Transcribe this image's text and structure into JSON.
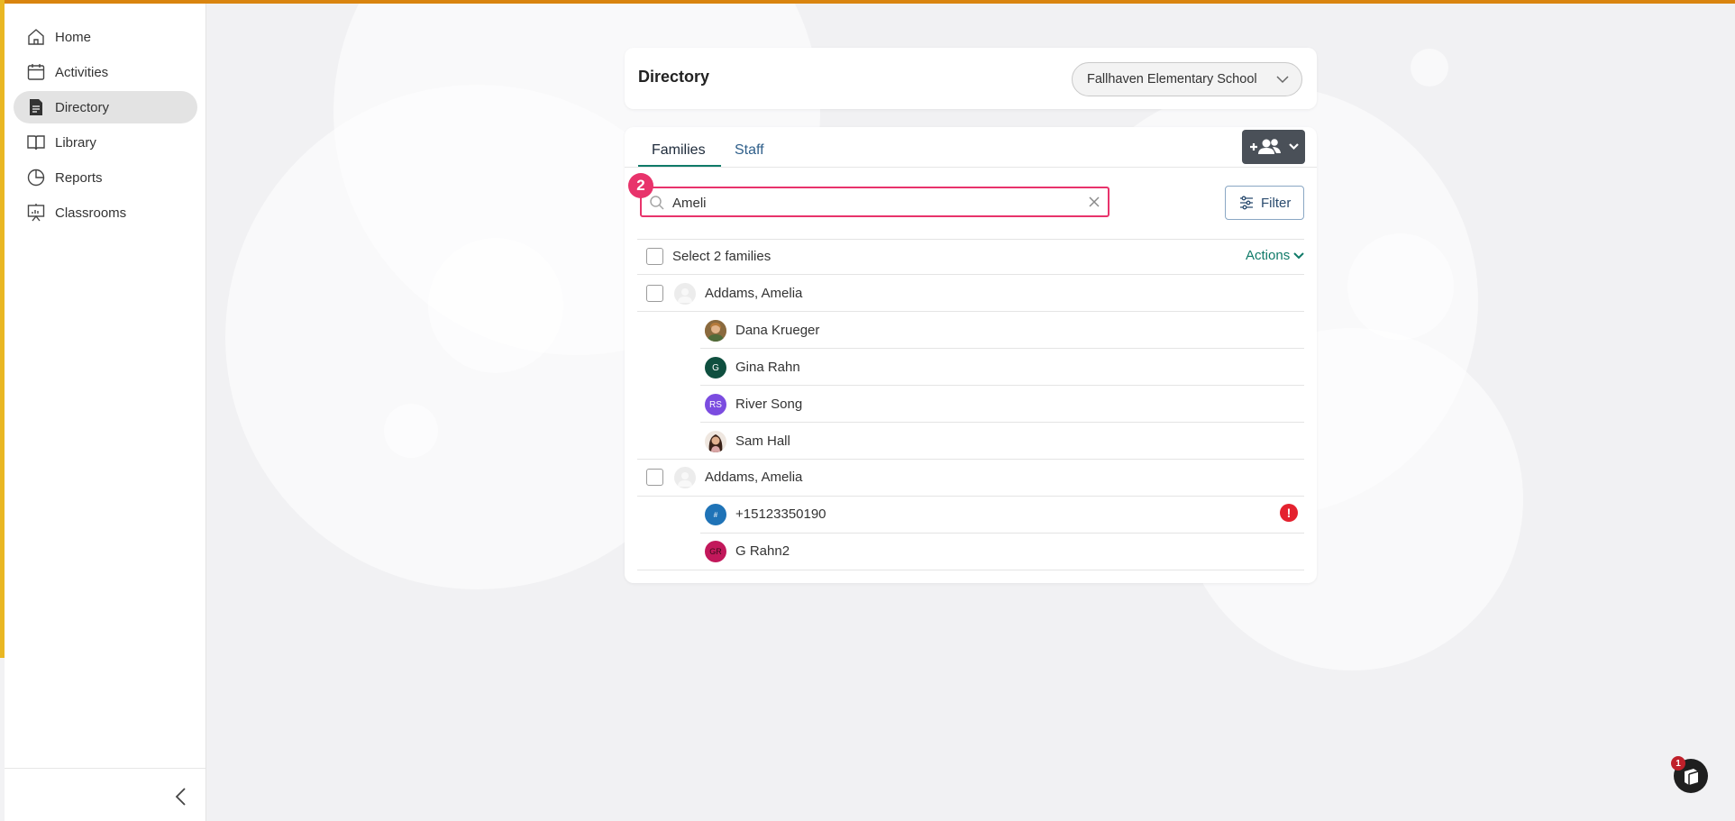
{
  "sidebar": {
    "items": [
      {
        "label": "Home",
        "icon": "home-icon",
        "active": false
      },
      {
        "label": "Activities",
        "icon": "calendar-icon",
        "active": false
      },
      {
        "label": "Directory",
        "icon": "directory-icon",
        "active": true
      },
      {
        "label": "Library",
        "icon": "book-icon",
        "active": false
      },
      {
        "label": "Reports",
        "icon": "pie-chart-icon",
        "active": false
      },
      {
        "label": "Classrooms",
        "icon": "classroom-icon",
        "active": false
      }
    ],
    "collapse_icon": "chevron-left-icon"
  },
  "header": {
    "title": "Directory",
    "school_select": {
      "value": "Fallhaven Elementary School",
      "icon": "chevron-down-icon"
    }
  },
  "directory": {
    "tabs": [
      {
        "label": "Families",
        "active": true
      },
      {
        "label": "Staff",
        "active": false
      }
    ],
    "add_button_icon": "add-people-icon",
    "search": {
      "value": "Ameli",
      "step_badge": "2"
    },
    "filter_label": "Filter",
    "select_all_label": "Select 2 families",
    "actions_label": "Actions",
    "families": [
      {
        "name": "Addams, Amelia",
        "members": [
          {
            "name": "Dana Krueger",
            "avatar": "photo",
            "initials": "",
            "color": "#b07a4a"
          },
          {
            "name": "Gina Rahn",
            "avatar": "initials",
            "initials": "G",
            "color": "#0f4f3f"
          },
          {
            "name": "River Song",
            "avatar": "initials",
            "initials": "RS",
            "color": "#7b4ce0"
          },
          {
            "name": "Sam Hall",
            "avatar": "photo",
            "initials": "",
            "color": "#6b4a3a"
          }
        ]
      },
      {
        "name": "Addams, Amelia",
        "members": [
          {
            "name": "+15123350190",
            "avatar": "initials",
            "initials": "#",
            "color": "#1f73b7",
            "alert": "!"
          },
          {
            "name": "G Rahn2",
            "avatar": "initials",
            "initials": "GR",
            "color": "#c2185b"
          }
        ]
      }
    ]
  },
  "helper": {
    "badge": "1"
  },
  "colors": {
    "accent": "#0f7a68",
    "highlight": "#e8336b",
    "top_bar": "#d9840f"
  }
}
